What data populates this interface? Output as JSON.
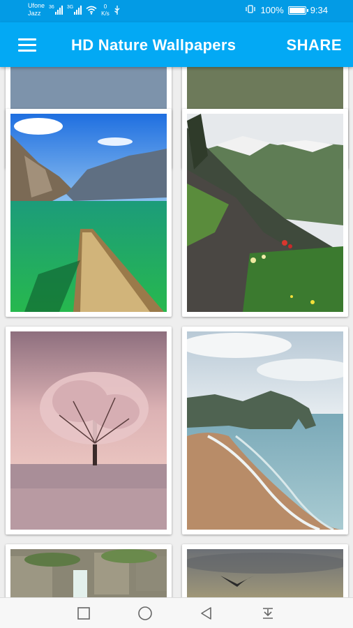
{
  "status_bar": {
    "carrier_line1": "Ufone",
    "carrier_line2": "Jazz",
    "sig1_tag": "36",
    "sig2_tag": "3G",
    "speed_value": "0",
    "speed_unit": "K/s",
    "battery_percent": "100%",
    "battery_level": 1.0,
    "time": "9:34"
  },
  "app_bar": {
    "title": "HD Nature Wallpapers",
    "share_label": "SHARE"
  },
  "wallpapers": [
    {
      "scene": "lake-reflection"
    },
    {
      "scene": "forest-floor"
    },
    {
      "scene": "mountain-lake-dock"
    },
    {
      "scene": "alpine-meadow"
    },
    {
      "scene": "pink-tree-beach"
    },
    {
      "scene": "coastal-arch"
    },
    {
      "scene": "stone-ruins-waterfall"
    },
    {
      "scene": "sunset-bird"
    }
  ],
  "nav_bar": {
    "icons": [
      "recent-apps-icon",
      "home-icon",
      "back-icon",
      "notification-pull-icon"
    ]
  },
  "colors": {
    "status_bar": "#039be5",
    "app_bar": "#03a9f4",
    "background": "#eeeeee"
  }
}
